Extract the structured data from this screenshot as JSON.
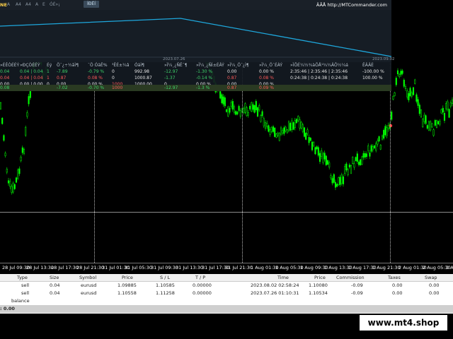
{
  "overlay": {
    "title": "NE",
    "toolbar": [
      "A",
      "A4",
      "A4",
      "A",
      "E",
      "ÓÉ»¡"
    ],
    "active_tab": "ÍÐÉÍ",
    "link": "ÂÃÅ http://MTCommander.com",
    "equity_dates": [
      "2023.07.26",
      "2023.09.02"
    ],
    "equity_color": "#1ea7dc",
    "headers": [
      "»ÉÊÒÉÉÝ",
      "»ÐÇÒÉÉÝ",
      "Éý",
      "Ö¯¿÷½ãÌ¶",
      "¯Ö ÓäË%",
      "³ÊÉ±¼â",
      "ÓäÌ¶",
      "»Ï¼¸¿ÑÊ¯¶",
      "»Ï¼¸¿ÑÌ±ÉÂÝ",
      "»Ï¼¸Ö¯¿Ì¶",
      "»Ï¼¸Ö¯ÉÀÝ",
      "»ÏÔÉ¼½¾àÕÅ¹¾¼ÄÕ½¼á",
      "ÊÂÂÈ"
    ],
    "rows": [
      [
        "0.04",
        "0.04 | 0.04",
        "1",
        "-7.89",
        "-0.79 %",
        "0",
        "992.98",
        "-12.97",
        "-1.30 %",
        "0.00",
        "0.00 %",
        "2:35:46 | 2:35:46 | 2:35:46",
        "-100.00 %"
      ],
      [
        "0.04",
        "0.04 | 0.04",
        "1",
        "0.87",
        "0.08 %",
        "0",
        "1000.87",
        "-1.37",
        "-0.14 %",
        "0.87",
        "0.08 %",
        "0:24:38 | 0:24:38 | 0:24:38",
        "100.00 %"
      ],
      [
        "0.00",
        "0.00 | 0.00",
        "0",
        "0.00",
        "0.00 %",
        "1000",
        "1000.00",
        "0",
        "0.00 %",
        "0.00",
        "0.00 %",
        "",
        ""
      ],
      [
        "0.08",
        "",
        "",
        "-7.02",
        "-0.70 %",
        "1000",
        "",
        "-12.97",
        "-1.3 %",
        "0.87",
        "0.09 %",
        "",
        ""
      ]
    ]
  },
  "chart_axis": {
    "x_labels": [
      "28 Jul 09:30",
      "28 Jul 13:30",
      "28 Jul 17:30",
      "28 Jul 21:30",
      "31 Jul 01:30",
      "31 Jul 05:30",
      "31 Jul 09:30",
      "31 Jul 13:30",
      "31 Jul 17:30",
      "31 Jul 21:30",
      "1 Aug 01:30",
      "1 Aug 05:30",
      "1 Aug 09:30",
      "1 Aug 13:30",
      "1 Aug 17:30",
      "1 Aug 21:30",
      "2 Aug 01:30",
      "2 Aug 05:30",
      "2 Aug 09:30"
    ],
    "candle_color": "#00ff00"
  },
  "terminal": {
    "columns": [
      "Type",
      "Size",
      "Symbol",
      "Price",
      "S / L",
      "T / P",
      "Time",
      "Price",
      "Commission",
      "Taxes",
      "Swap"
    ],
    "rows": [
      [
        "sell",
        "0.04",
        "eurusd",
        "1.09885",
        "1.10585",
        "0.00000",
        "2023.08.02 02:58:24",
        "1.10080",
        "-0.09",
        "0.00",
        "0.00"
      ],
      [
        "sell",
        "0.04",
        "eurusd",
        "1.10558",
        "1.11258",
        "0.00000",
        "2023.07.26 01:10:31",
        "1.10534",
        "-0.09",
        "0.00",
        "0.00"
      ]
    ],
    "balance_label": "balance",
    "total_label": ": 0.00"
  },
  "watermark": "www.mt4.shop"
}
